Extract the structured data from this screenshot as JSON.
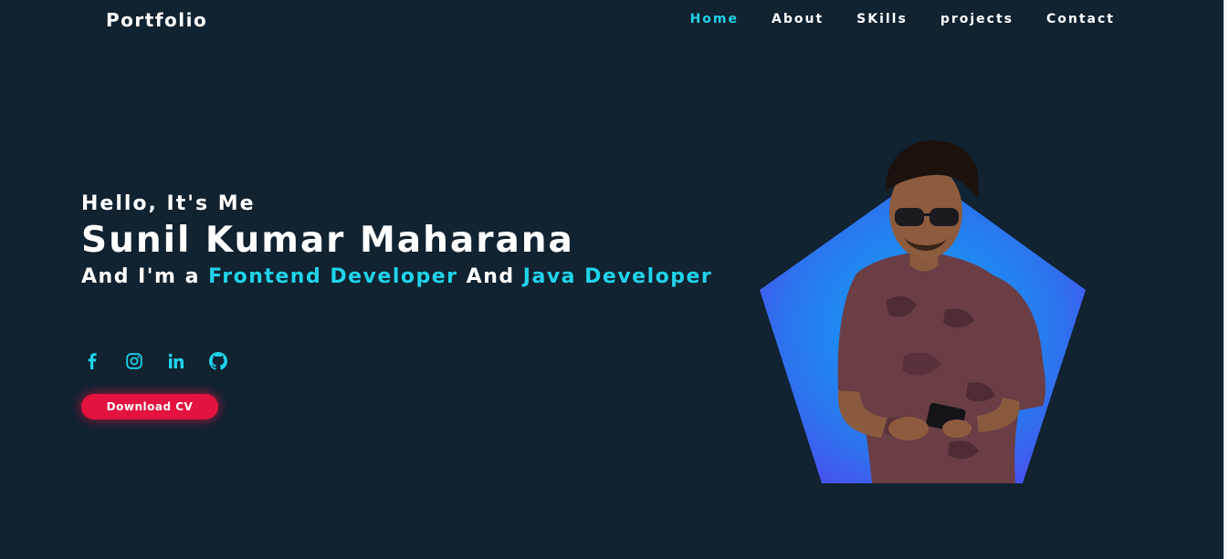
{
  "header": {
    "brand": "Portfolio",
    "nav": [
      {
        "label": "Home",
        "active": true
      },
      {
        "label": "About",
        "active": false
      },
      {
        "label": "SKills",
        "active": false
      },
      {
        "label": "projects",
        "active": false
      },
      {
        "label": "Contact",
        "active": false
      }
    ]
  },
  "hero": {
    "greeting": "Hello, It's Me",
    "name": "Sunil Kumar Maharana",
    "role_prefix": "And I'm a",
    "role_1": "Frontend Developer",
    "role_join": "And",
    "role_2": "Java Developer",
    "cv_button": "Download CV"
  },
  "socials": [
    {
      "icon": "facebook-icon"
    },
    {
      "icon": "instagram-icon"
    },
    {
      "icon": "linkedin-icon"
    },
    {
      "icon": "github-icon"
    }
  ],
  "colors": {
    "background": "#112230",
    "accent": "#1fd3ea",
    "button": "#e3123f",
    "shape_from": "#1e90ff",
    "shape_to": "#4b4ff0"
  }
}
